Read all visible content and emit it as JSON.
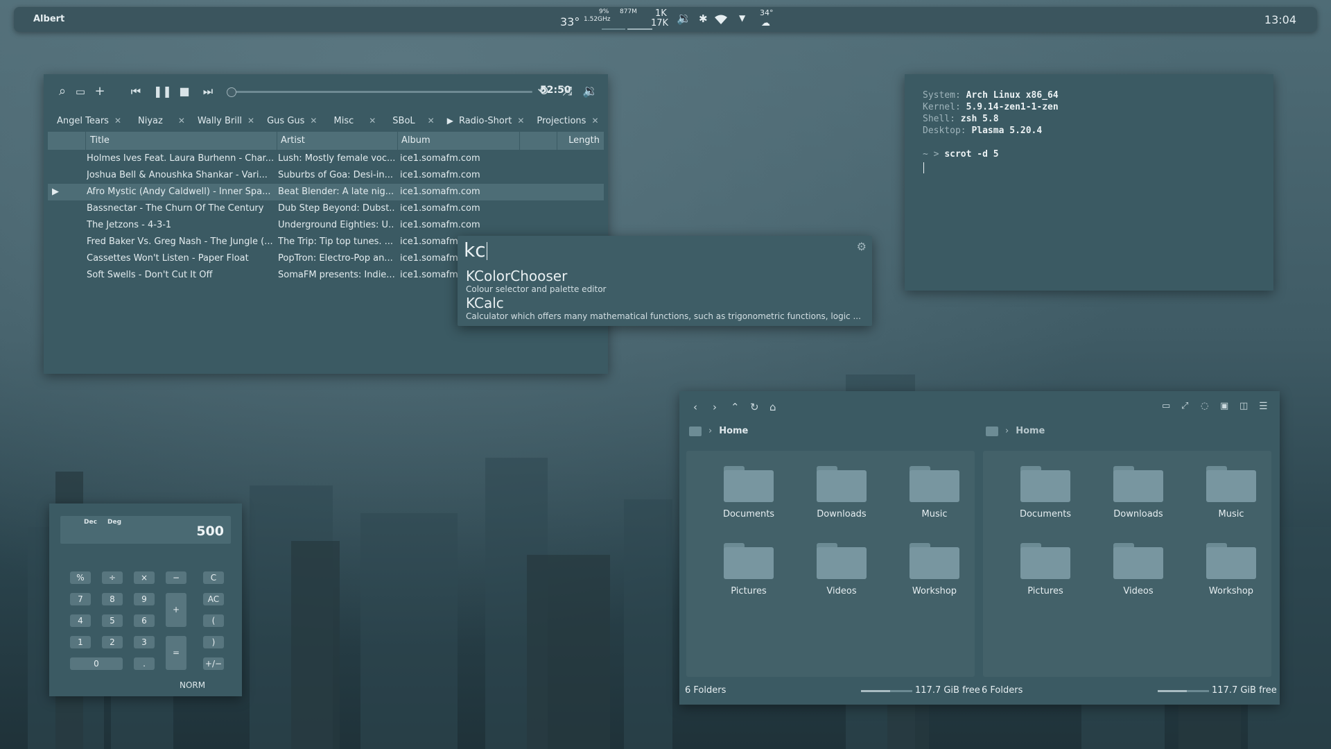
{
  "topbar": {
    "launcher": "Albert",
    "temperature": "33°",
    "cpu_percent": "9%",
    "cpu_freq": "1.52GHz",
    "memory": "877M",
    "net_up": "1K",
    "net_down": "17K",
    "weather_temp": "34°",
    "clock": "13:04"
  },
  "player": {
    "time": "52:50",
    "tabs": [
      {
        "label": "Angel Tears"
      },
      {
        "label": "Niyaz"
      },
      {
        "label": "Wally Brill"
      },
      {
        "label": "Gus Gus"
      },
      {
        "label": "Misc"
      },
      {
        "label": "SBoL"
      },
      {
        "label": "Radio-Short"
      },
      {
        "label": "Projections"
      }
    ],
    "columns": {
      "title": "Title",
      "artist": "Artist",
      "album": "Album",
      "length": "Length"
    },
    "rows": [
      {
        "title": "Holmes Ives Feat. Laura Burhenn - Char...",
        "artist": "Lush: Mostly female voc...",
        "album": "ice1.somafm.com"
      },
      {
        "title": "Joshua Bell & Anoushka Shankar - Vari...",
        "artist": "Suburbs of Goa: Desi-in...",
        "album": "ice1.somafm.com"
      },
      {
        "title": "Afro Mystic (Andy Caldwell) - Inner Spa...",
        "artist": "Beat Blender: A late nig...",
        "album": "ice1.somafm.com"
      },
      {
        "title": "Bassnectar - The Churn Of The Century",
        "artist": "Dub Step Beyond: Dubst...",
        "album": "ice1.somafm.com"
      },
      {
        "title": "The Jetzons - 4-3-1",
        "artist": "Underground Eighties: U...",
        "album": "ice1.somafm.com"
      },
      {
        "title": "Fred Baker Vs. Greg Nash - The Jungle (...",
        "artist": "The Trip:  Tip top tunes. ...",
        "album": "ice1.somafm."
      },
      {
        "title": "Cassettes Won't Listen - Paper Float",
        "artist": "PopTron: Electro-Pop an...",
        "album": "ice1.somafm."
      },
      {
        "title": "Soft Swells - Don't Cut It Off",
        "artist": "SomaFM presents: Indie...",
        "album": "ice1.somafm."
      }
    ]
  },
  "albert": {
    "query": "kc",
    "results": [
      {
        "name": "KColorChooser",
        "desc": "Colour selector and palette editor"
      },
      {
        "name": "KCalc",
        "desc": "Calculator which offers many mathematical functions, such as trigonometric functions, logic ..."
      }
    ]
  },
  "terminal": {
    "lines": [
      {
        "key": "System",
        "value": "Arch Linux x86_64"
      },
      {
        "key": "Kernel",
        "value": "5.9.14-zen1-1-zen"
      },
      {
        "key": "Shell",
        "value": "zsh 5.8"
      },
      {
        "key": "Desktop",
        "value": "Plasma 5.20.4"
      }
    ],
    "prompt": "~ >",
    "command": "scrot -d 5"
  },
  "filemanager": {
    "left": {
      "breadcrumb": "Home",
      "folders": [
        "Documents",
        "Downloads",
        "Music",
        "Pictures",
        "Videos",
        "Workshop"
      ],
      "status": "6 Folders",
      "free": "117.7 GiB free"
    },
    "right": {
      "breadcrumb": "Home",
      "folders": [
        "Documents",
        "Downloads",
        "Music",
        "Pictures",
        "Videos",
        "Workshop"
      ],
      "status": "6 Folders",
      "free": "117.7 GiB free"
    }
  },
  "calculator": {
    "mode_dec": "Dec",
    "mode_deg": "Deg",
    "display": "500",
    "status": "NORM",
    "keys": [
      "%",
      "÷",
      "×",
      "−",
      "C",
      "7",
      "8",
      "9",
      "+",
      "AC",
      "4",
      "5",
      "6",
      "(",
      "1",
      "2",
      "3",
      "=",
      ")",
      "0",
      ".",
      "+/−"
    ]
  }
}
